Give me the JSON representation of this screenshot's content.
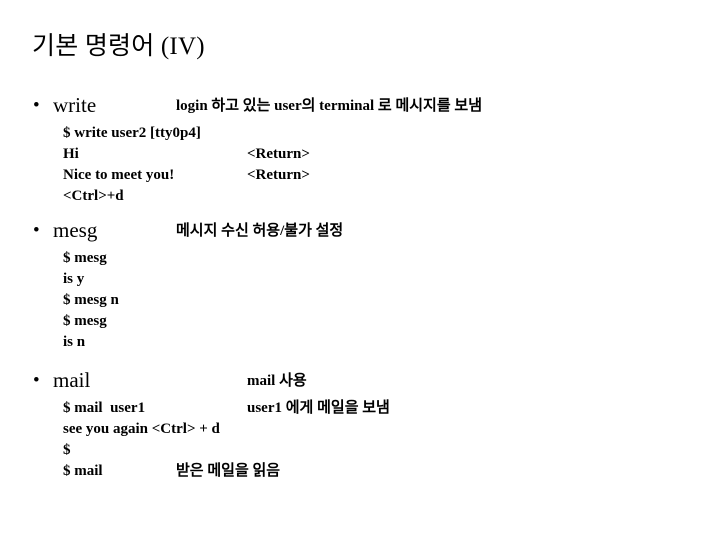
{
  "slide": {
    "title": "기본 명령어 (IV)",
    "bullet_glyph": "•",
    "sections": [
      {
        "command": "write",
        "description": "login 하고 있는 user의 terminal 로 메시지를 보냄",
        "desc_column": "col-a",
        "lines": [
          {
            "text": "$ write user2 [tty0p4]",
            "note": "",
            "note_column": "col-b"
          },
          {
            "text": "Hi",
            "note": "<Return>",
            "note_column": "col-b"
          },
          {
            "text": "Nice to meet you!",
            "note": "<Return>",
            "note_column": "col-b"
          },
          {
            "text": "<Ctrl>+d",
            "note": "",
            "note_column": "col-b"
          }
        ]
      },
      {
        "command": "mesg",
        "description": "메시지 수신 허용/불가 설정",
        "desc_column": "col-a",
        "lines": [
          {
            "text": "$ mesg",
            "note": "",
            "note_column": "col-a"
          },
          {
            "text": "is y",
            "note": "",
            "note_column": "col-a"
          },
          {
            "text": "$ mesg n",
            "note": "",
            "note_column": "col-a"
          },
          {
            "text": "$ mesg",
            "note": "",
            "note_column": "col-a"
          },
          {
            "text": "is n",
            "note": "",
            "note_column": "col-a"
          }
        ]
      },
      {
        "command": "mail",
        "description": "mail 사용",
        "desc_column": "col-b",
        "lines": [
          {
            "text": "$ mail  user1",
            "note": "user1 에게 메일을 보냄",
            "note_column": "col-b"
          },
          {
            "text": "see you again <Ctrl> + d",
            "note": "",
            "note_column": "col-b"
          },
          {
            "text": "$",
            "note": "",
            "note_column": "col-b"
          },
          {
            "text": "$ mail",
            "note": "받은 메일을 읽음",
            "note_column": "col-a"
          }
        ]
      }
    ]
  }
}
